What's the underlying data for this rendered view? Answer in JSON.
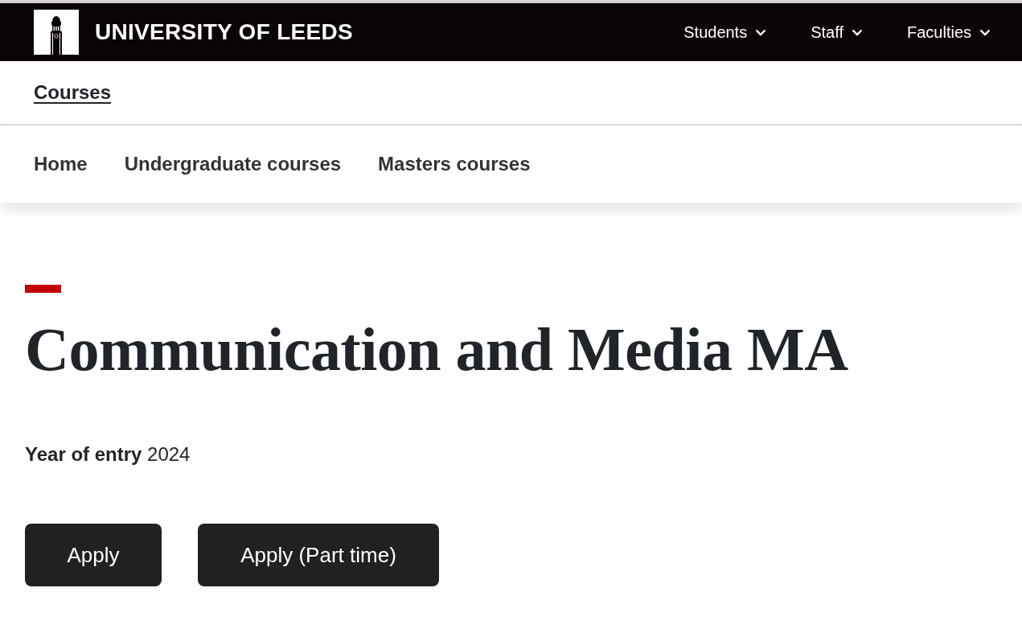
{
  "header": {
    "logo_text": "UNIVERSITY OF LEEDS",
    "nav": [
      {
        "label": "Students",
        "expanded": false
      },
      {
        "label": "Staff",
        "expanded": false
      },
      {
        "label": "Faculties",
        "expanded": false
      }
    ]
  },
  "section": {
    "title": "Courses"
  },
  "subnav": [
    {
      "label": "Home"
    },
    {
      "label": "Undergraduate courses"
    },
    {
      "label": "Masters courses"
    }
  ],
  "course": {
    "title": "Communication and Media MA",
    "year_of_entry": "**Year of entry** 2024"
  },
  "buttons": [
    "Apply",
    "Apply (Part time)"
  ]
}
